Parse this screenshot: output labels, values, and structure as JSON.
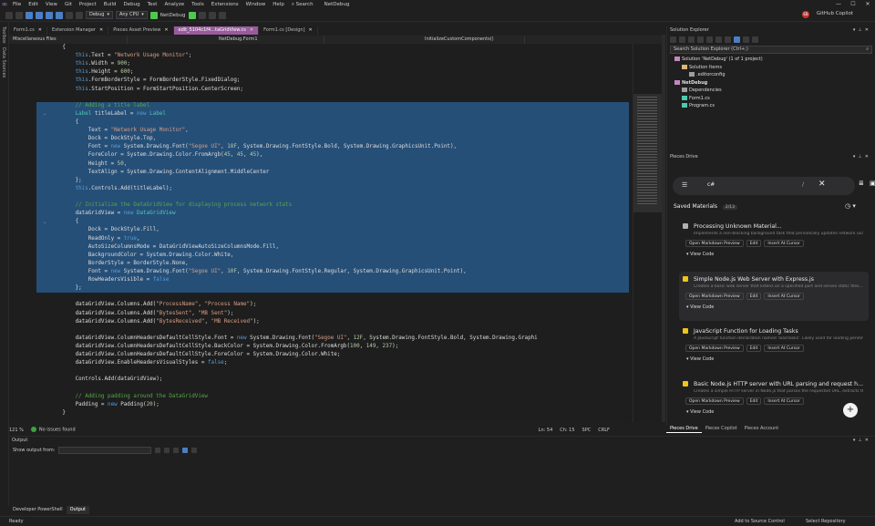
{
  "menu": {
    "items": [
      "File",
      "Edit",
      "View",
      "Git",
      "Project",
      "Build",
      "Debug",
      "Test",
      "Analyze",
      "Tools",
      "Extensions",
      "Window",
      "Help"
    ],
    "search_label": "Search",
    "solution_name": "NetDebug"
  },
  "toolbar": {
    "config": "Debug",
    "platform": "Any CPU",
    "run_target": "NetDebug",
    "avatar_initials": "EB",
    "copilot_label": "GitHub Copilot"
  },
  "leftstrip": {
    "items": [
      "Toolbox",
      "Data Sources"
    ]
  },
  "doctabs": [
    {
      "label": "Form1.cs",
      "active": false
    },
    {
      "label": "Extension Manager",
      "active": false
    },
    {
      "label": "Pieces Asset Preview",
      "active": false
    },
    {
      "label": "edit_5104c1f4...taGridView.cs",
      "active": true
    },
    {
      "label": "Form1.cs [Design]",
      "active": false
    }
  ],
  "navbar": {
    "scope": "Miscellaneous Files",
    "class": "NetDebug.Form1",
    "member": "InitializeCustomComponents()"
  },
  "code_lines": [
    {
      "indent": 8,
      "tokens": [
        [
          "p",
          "{"
        ]
      ]
    },
    {
      "indent": 12,
      "tokens": [
        [
          "k",
          "this"
        ],
        [
          "p",
          ".Text = "
        ],
        [
          "s",
          "\"Network Usage Monitor\""
        ],
        [
          "p",
          ";"
        ]
      ]
    },
    {
      "indent": 12,
      "tokens": [
        [
          "k",
          "this"
        ],
        [
          "p",
          ".Width = "
        ],
        [
          "n",
          "900"
        ],
        [
          "p",
          ";"
        ]
      ]
    },
    {
      "indent": 12,
      "tokens": [
        [
          "k",
          "this"
        ],
        [
          "p",
          ".Height = "
        ],
        [
          "n",
          "600"
        ],
        [
          "p",
          ";"
        ]
      ]
    },
    {
      "indent": 12,
      "tokens": [
        [
          "k",
          "this"
        ],
        [
          "p",
          ".FormBorderStyle = FormBorderStyle.FixedDialog;"
        ]
      ]
    },
    {
      "indent": 12,
      "tokens": [
        [
          "k",
          "this"
        ],
        [
          "p",
          ".StartPosition = FormStartPosition.CenterScreen;"
        ]
      ]
    },
    {
      "indent": 0,
      "tokens": []
    },
    {
      "indent": 12,
      "sel": true,
      "tokens": [
        [
          "c",
          "// Adding a title label"
        ]
      ]
    },
    {
      "indent": 12,
      "sel": true,
      "tokens": [
        [
          "t",
          "Label"
        ],
        [
          "p",
          " titleLabel = "
        ],
        [
          "k",
          "new"
        ],
        [
          "p",
          " "
        ],
        [
          "t",
          "Label"
        ]
      ]
    },
    {
      "indent": 12,
      "sel": true,
      "tokens": [
        [
          "p",
          "{"
        ]
      ]
    },
    {
      "indent": 16,
      "sel": true,
      "tokens": [
        [
          "p",
          "Text = "
        ],
        [
          "s",
          "\"Network Usage Monitor\""
        ],
        [
          "p",
          ","
        ]
      ]
    },
    {
      "indent": 16,
      "sel": true,
      "tokens": [
        [
          "p",
          "Dock = DockStyle.Top,"
        ]
      ]
    },
    {
      "indent": 16,
      "sel": true,
      "tokens": [
        [
          "p",
          "Font = "
        ],
        [
          "k",
          "new"
        ],
        [
          "p",
          " System.Drawing.Font("
        ],
        [
          "s",
          "\"Segoe UI\""
        ],
        [
          "p",
          ", "
        ],
        [
          "n",
          "18F"
        ],
        [
          "p",
          ", System.Drawing.FontStyle.Bold, System.Drawing.GraphicsUnit.Point),"
        ]
      ]
    },
    {
      "indent": 16,
      "sel": true,
      "tokens": [
        [
          "p",
          "ForeColor = System.Drawing.Color.FromArgb("
        ],
        [
          "n",
          "45"
        ],
        [
          "p",
          ", "
        ],
        [
          "n",
          "45"
        ],
        [
          "p",
          ", "
        ],
        [
          "n",
          "45"
        ],
        [
          "p",
          "),"
        ]
      ]
    },
    {
      "indent": 16,
      "sel": true,
      "tokens": [
        [
          "p",
          "Height = "
        ],
        [
          "n",
          "50"
        ],
        [
          "p",
          ","
        ]
      ]
    },
    {
      "indent": 16,
      "sel": true,
      "tokens": [
        [
          "p",
          "TextAlign = System.Drawing.ContentAlignment.MiddleCenter"
        ]
      ]
    },
    {
      "indent": 12,
      "sel": true,
      "tokens": [
        [
          "p",
          "};"
        ]
      ]
    },
    {
      "indent": 12,
      "sel": true,
      "tokens": [
        [
          "k",
          "this"
        ],
        [
          "p",
          ".Controls.Add(titleLabel);"
        ]
      ]
    },
    {
      "indent": 0,
      "sel": true,
      "tokens": []
    },
    {
      "indent": 12,
      "sel": true,
      "tokens": [
        [
          "c",
          "// Initialize the DataGridView for displaying process network stats"
        ]
      ]
    },
    {
      "indent": 12,
      "sel": true,
      "tokens": [
        [
          "p",
          "dataGridView = "
        ],
        [
          "k",
          "new"
        ],
        [
          "p",
          " "
        ],
        [
          "t",
          "DataGridView"
        ]
      ]
    },
    {
      "indent": 12,
      "sel": true,
      "tokens": [
        [
          "p",
          "{"
        ]
      ]
    },
    {
      "indent": 16,
      "sel": true,
      "tokens": [
        [
          "p",
          "Dock = DockStyle.Fill,"
        ]
      ]
    },
    {
      "indent": 16,
      "sel": true,
      "tokens": [
        [
          "p",
          "ReadOnly = "
        ],
        [
          "k",
          "true"
        ],
        [
          "p",
          ","
        ]
      ]
    },
    {
      "indent": 16,
      "sel": true,
      "tokens": [
        [
          "p",
          "AutoSizeColumnsMode = DataGridViewAutoSizeColumnsMode.Fill,"
        ]
      ]
    },
    {
      "indent": 16,
      "sel": true,
      "tokens": [
        [
          "p",
          "BackgroundColor = System.Drawing.Color.White,"
        ]
      ]
    },
    {
      "indent": 16,
      "sel": true,
      "tokens": [
        [
          "p",
          "BorderStyle = BorderStyle.None,"
        ]
      ]
    },
    {
      "indent": 16,
      "sel": true,
      "tokens": [
        [
          "p",
          "Font = "
        ],
        [
          "k",
          "new"
        ],
        [
          "p",
          " System.Drawing.Font("
        ],
        [
          "s",
          "\"Segoe UI\""
        ],
        [
          "p",
          ", "
        ],
        [
          "n",
          "10F"
        ],
        [
          "p",
          ", System.Drawing.FontStyle.Regular, System.Drawing.GraphicsUnit.Point),"
        ]
      ]
    },
    {
      "indent": 16,
      "sel": true,
      "tokens": [
        [
          "p",
          "RowHeadersVisible = "
        ],
        [
          "k",
          "false"
        ]
      ]
    },
    {
      "indent": 12,
      "sel": true,
      "tokens": [
        [
          "p",
          "};"
        ]
      ]
    },
    {
      "indent": 0,
      "tokens": []
    },
    {
      "indent": 12,
      "tokens": [
        [
          "p",
          "dataGridView.Columns.Add("
        ],
        [
          "s",
          "\"ProcessName\""
        ],
        [
          "p",
          ", "
        ],
        [
          "s",
          "\"Process Name\""
        ],
        [
          "p",
          ");"
        ]
      ]
    },
    {
      "indent": 12,
      "tokens": [
        [
          "p",
          "dataGridView.Columns.Add("
        ],
        [
          "s",
          "\"BytesSent\""
        ],
        [
          "p",
          ", "
        ],
        [
          "s",
          "\"MB Sent\""
        ],
        [
          "p",
          ");"
        ]
      ]
    },
    {
      "indent": 12,
      "tokens": [
        [
          "p",
          "dataGridView.Columns.Add("
        ],
        [
          "s",
          "\"BytesReceived\""
        ],
        [
          "p",
          ", "
        ],
        [
          "s",
          "\"MB Received\""
        ],
        [
          "p",
          ");"
        ]
      ]
    },
    {
      "indent": 0,
      "tokens": []
    },
    {
      "indent": 12,
      "tokens": [
        [
          "p",
          "dataGridView.ColumnHeadersDefaultCellStyle.Font = "
        ],
        [
          "k",
          "new"
        ],
        [
          "p",
          " System.Drawing.Font("
        ],
        [
          "s",
          "\"Segoe UI\""
        ],
        [
          "p",
          ", "
        ],
        [
          "n",
          "12F"
        ],
        [
          "p",
          ", System.Drawing.FontStyle.Bold, System.Drawing.Graphi"
        ]
      ]
    },
    {
      "indent": 12,
      "tokens": [
        [
          "p",
          "dataGridView.ColumnHeadersDefaultCellStyle.BackColor = System.Drawing.Color.FromArgb("
        ],
        [
          "n",
          "100"
        ],
        [
          "p",
          ", "
        ],
        [
          "n",
          "149"
        ],
        [
          "p",
          ", "
        ],
        [
          "n",
          "237"
        ],
        [
          "p",
          ");"
        ]
      ]
    },
    {
      "indent": 12,
      "tokens": [
        [
          "p",
          "dataGridView.ColumnHeadersDefaultCellStyle.ForeColor = System.Drawing.Color.White;"
        ]
      ]
    },
    {
      "indent": 12,
      "tokens": [
        [
          "p",
          "dataGridView.EnableHeadersVisualStyles = "
        ],
        [
          "k",
          "false"
        ],
        [
          "p",
          ";"
        ]
      ]
    },
    {
      "indent": 0,
      "tokens": []
    },
    {
      "indent": 12,
      "tokens": [
        [
          "p",
          "Controls.Add(dataGridView);"
        ]
      ]
    },
    {
      "indent": 0,
      "tokens": []
    },
    {
      "indent": 12,
      "tokens": [
        [
          "c",
          "// Adding padding around the DataGridView"
        ]
      ]
    },
    {
      "indent": 12,
      "tokens": [
        [
          "p",
          "Padding = "
        ],
        [
          "k",
          "new"
        ],
        [
          "p",
          " Padding("
        ],
        [
          "n",
          "20"
        ],
        [
          "p",
          ");"
        ]
      ]
    },
    {
      "indent": 8,
      "tokens": [
        [
          "p",
          "}"
        ]
      ]
    }
  ],
  "editor_status": {
    "zoom": "121 %",
    "issues": "No issues found",
    "line": "Ln: 54",
    "char": "Ch: 15",
    "spc": "SPC",
    "eol": "CRLF"
  },
  "solution_explorer": {
    "title": "Solution Explorer",
    "search_placeholder": "Search Solution Explorer (Ctrl+;)",
    "tree": [
      {
        "label": "Solution 'NetDebug' (1 of 1 project)",
        "depth": 0
      },
      {
        "label": "Solution Items",
        "depth": 1
      },
      {
        "label": ".editorconfig",
        "depth": 2
      },
      {
        "label": "NetDebug",
        "depth": 0,
        "bold": true
      },
      {
        "label": "Dependencies",
        "depth": 1
      },
      {
        "label": "Form1.cs",
        "depth": 1
      },
      {
        "label": "Program.cs",
        "depth": 1
      }
    ]
  },
  "pieces": {
    "title": "Pieces Drive",
    "search_value": "c#",
    "saved_label": "Saved Materials",
    "saved_count": "2/13",
    "cards": [
      {
        "title": "Processing Unknown Material...",
        "desc": "Implements a non-blocking background task that periodically updates network usage...",
        "icon_color": "#b0b0b0",
        "highlight": false
      },
      {
        "title": "Simple Node.js Web Server with Express.js",
        "desc": "Creates a basic web server that listens on a specified port and serves static files...",
        "icon_color": "#f0c419",
        "highlight": true
      },
      {
        "title": "JavaScript Function for Loading Tasks",
        "desc": "A JavaScript function declaration named 'loadTasks'. Likely used for loading pending...",
        "icon_color": "#f0c419",
        "highlight": false
      },
      {
        "title": "Basic Node.js HTTP server with URL parsing and request h...",
        "desc": "Creates a simple HTTP server in Node.js that parses the requested URL, extracts the...",
        "icon_color": "#f0c419",
        "highlight": false
      }
    ],
    "btn_preview": "Open Markdown Preview",
    "btn_edit": "Edit",
    "btn_insert": "Insert At Cursor",
    "view_code": "View Code",
    "tabs": [
      "Pieces Drive",
      "Pieces Copilot",
      "Pieces Account"
    ]
  },
  "output": {
    "title": "Output",
    "show_from": "Show output from:"
  },
  "bottomtabs": [
    "Developer PowerShell",
    "Output"
  ],
  "statusbar": {
    "ready": "Ready",
    "source_control": "Add to Source Control",
    "repo": "Select Repository"
  }
}
